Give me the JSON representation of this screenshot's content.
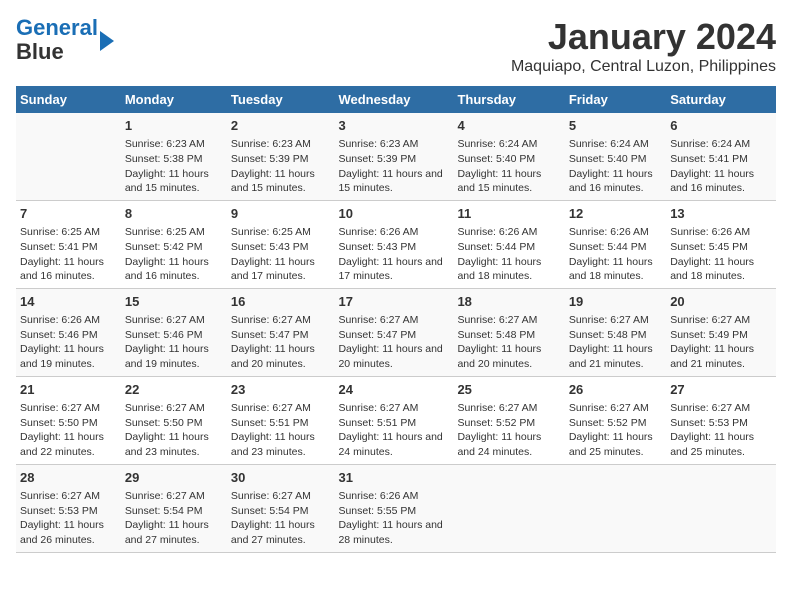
{
  "logo": {
    "line1": "General",
    "line2": "Blue"
  },
  "title": "January 2024",
  "subtitle": "Maquiapo, Central Luzon, Philippines",
  "days_header": [
    "Sunday",
    "Monday",
    "Tuesday",
    "Wednesday",
    "Thursday",
    "Friday",
    "Saturday"
  ],
  "weeks": [
    [
      {
        "num": "",
        "sunrise": "",
        "sunset": "",
        "daylight": ""
      },
      {
        "num": "1",
        "sunrise": "Sunrise: 6:23 AM",
        "sunset": "Sunset: 5:38 PM",
        "daylight": "Daylight: 11 hours and 15 minutes."
      },
      {
        "num": "2",
        "sunrise": "Sunrise: 6:23 AM",
        "sunset": "Sunset: 5:39 PM",
        "daylight": "Daylight: 11 hours and 15 minutes."
      },
      {
        "num": "3",
        "sunrise": "Sunrise: 6:23 AM",
        "sunset": "Sunset: 5:39 PM",
        "daylight": "Daylight: 11 hours and 15 minutes."
      },
      {
        "num": "4",
        "sunrise": "Sunrise: 6:24 AM",
        "sunset": "Sunset: 5:40 PM",
        "daylight": "Daylight: 11 hours and 15 minutes."
      },
      {
        "num": "5",
        "sunrise": "Sunrise: 6:24 AM",
        "sunset": "Sunset: 5:40 PM",
        "daylight": "Daylight: 11 hours and 16 minutes."
      },
      {
        "num": "6",
        "sunrise": "Sunrise: 6:24 AM",
        "sunset": "Sunset: 5:41 PM",
        "daylight": "Daylight: 11 hours and 16 minutes."
      }
    ],
    [
      {
        "num": "7",
        "sunrise": "Sunrise: 6:25 AM",
        "sunset": "Sunset: 5:41 PM",
        "daylight": "Daylight: 11 hours and 16 minutes."
      },
      {
        "num": "8",
        "sunrise": "Sunrise: 6:25 AM",
        "sunset": "Sunset: 5:42 PM",
        "daylight": "Daylight: 11 hours and 16 minutes."
      },
      {
        "num": "9",
        "sunrise": "Sunrise: 6:25 AM",
        "sunset": "Sunset: 5:43 PM",
        "daylight": "Daylight: 11 hours and 17 minutes."
      },
      {
        "num": "10",
        "sunrise": "Sunrise: 6:26 AM",
        "sunset": "Sunset: 5:43 PM",
        "daylight": "Daylight: 11 hours and 17 minutes."
      },
      {
        "num": "11",
        "sunrise": "Sunrise: 6:26 AM",
        "sunset": "Sunset: 5:44 PM",
        "daylight": "Daylight: 11 hours and 18 minutes."
      },
      {
        "num": "12",
        "sunrise": "Sunrise: 6:26 AM",
        "sunset": "Sunset: 5:44 PM",
        "daylight": "Daylight: 11 hours and 18 minutes."
      },
      {
        "num": "13",
        "sunrise": "Sunrise: 6:26 AM",
        "sunset": "Sunset: 5:45 PM",
        "daylight": "Daylight: 11 hours and 18 minutes."
      }
    ],
    [
      {
        "num": "14",
        "sunrise": "Sunrise: 6:26 AM",
        "sunset": "Sunset: 5:46 PM",
        "daylight": "Daylight: 11 hours and 19 minutes."
      },
      {
        "num": "15",
        "sunrise": "Sunrise: 6:27 AM",
        "sunset": "Sunset: 5:46 PM",
        "daylight": "Daylight: 11 hours and 19 minutes."
      },
      {
        "num": "16",
        "sunrise": "Sunrise: 6:27 AM",
        "sunset": "Sunset: 5:47 PM",
        "daylight": "Daylight: 11 hours and 20 minutes."
      },
      {
        "num": "17",
        "sunrise": "Sunrise: 6:27 AM",
        "sunset": "Sunset: 5:47 PM",
        "daylight": "Daylight: 11 hours and 20 minutes."
      },
      {
        "num": "18",
        "sunrise": "Sunrise: 6:27 AM",
        "sunset": "Sunset: 5:48 PM",
        "daylight": "Daylight: 11 hours and 20 minutes."
      },
      {
        "num": "19",
        "sunrise": "Sunrise: 6:27 AM",
        "sunset": "Sunset: 5:48 PM",
        "daylight": "Daylight: 11 hours and 21 minutes."
      },
      {
        "num": "20",
        "sunrise": "Sunrise: 6:27 AM",
        "sunset": "Sunset: 5:49 PM",
        "daylight": "Daylight: 11 hours and 21 minutes."
      }
    ],
    [
      {
        "num": "21",
        "sunrise": "Sunrise: 6:27 AM",
        "sunset": "Sunset: 5:50 PM",
        "daylight": "Daylight: 11 hours and 22 minutes."
      },
      {
        "num": "22",
        "sunrise": "Sunrise: 6:27 AM",
        "sunset": "Sunset: 5:50 PM",
        "daylight": "Daylight: 11 hours and 23 minutes."
      },
      {
        "num": "23",
        "sunrise": "Sunrise: 6:27 AM",
        "sunset": "Sunset: 5:51 PM",
        "daylight": "Daylight: 11 hours and 23 minutes."
      },
      {
        "num": "24",
        "sunrise": "Sunrise: 6:27 AM",
        "sunset": "Sunset: 5:51 PM",
        "daylight": "Daylight: 11 hours and 24 minutes."
      },
      {
        "num": "25",
        "sunrise": "Sunrise: 6:27 AM",
        "sunset": "Sunset: 5:52 PM",
        "daylight": "Daylight: 11 hours and 24 minutes."
      },
      {
        "num": "26",
        "sunrise": "Sunrise: 6:27 AM",
        "sunset": "Sunset: 5:52 PM",
        "daylight": "Daylight: 11 hours and 25 minutes."
      },
      {
        "num": "27",
        "sunrise": "Sunrise: 6:27 AM",
        "sunset": "Sunset: 5:53 PM",
        "daylight": "Daylight: 11 hours and 25 minutes."
      }
    ],
    [
      {
        "num": "28",
        "sunrise": "Sunrise: 6:27 AM",
        "sunset": "Sunset: 5:53 PM",
        "daylight": "Daylight: 11 hours and 26 minutes."
      },
      {
        "num": "29",
        "sunrise": "Sunrise: 6:27 AM",
        "sunset": "Sunset: 5:54 PM",
        "daylight": "Daylight: 11 hours and 27 minutes."
      },
      {
        "num": "30",
        "sunrise": "Sunrise: 6:27 AM",
        "sunset": "Sunset: 5:54 PM",
        "daylight": "Daylight: 11 hours and 27 minutes."
      },
      {
        "num": "31",
        "sunrise": "Sunrise: 6:26 AM",
        "sunset": "Sunset: 5:55 PM",
        "daylight": "Daylight: 11 hours and 28 minutes."
      },
      {
        "num": "",
        "sunrise": "",
        "sunset": "",
        "daylight": ""
      },
      {
        "num": "",
        "sunrise": "",
        "sunset": "",
        "daylight": ""
      },
      {
        "num": "",
        "sunrise": "",
        "sunset": "",
        "daylight": ""
      }
    ]
  ]
}
